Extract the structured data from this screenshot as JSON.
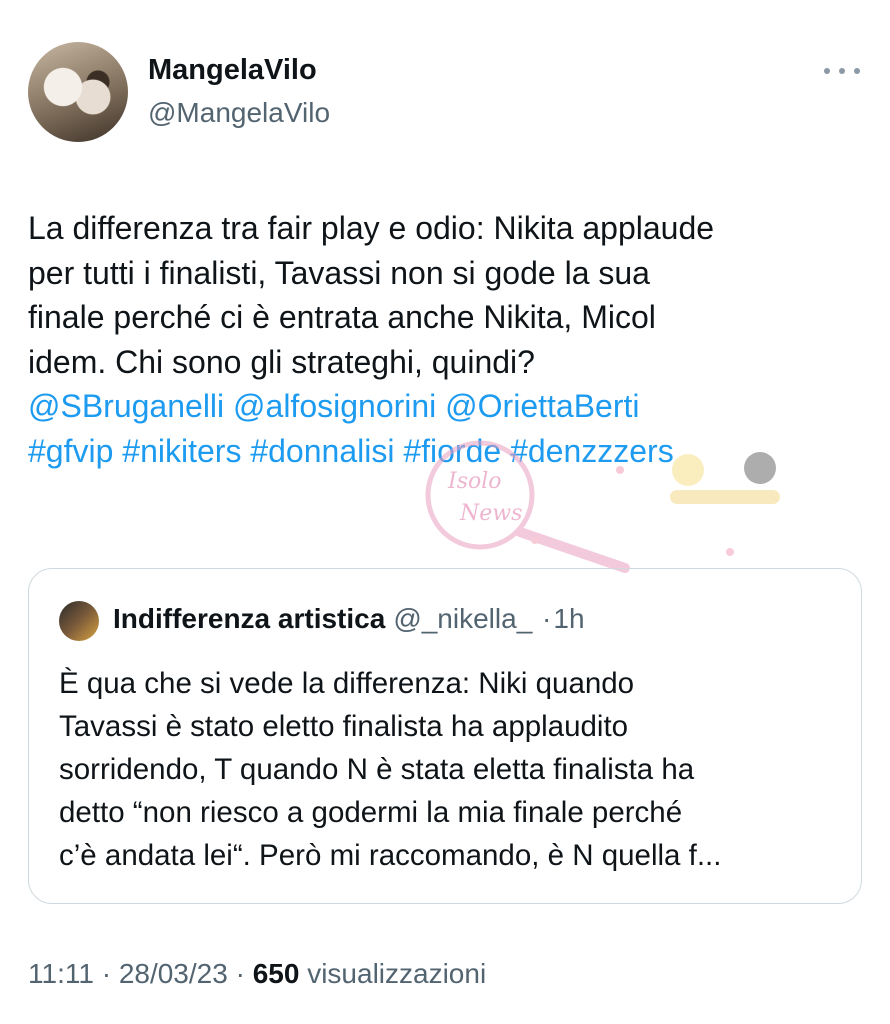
{
  "author": {
    "display_name": "MangelaVilo",
    "handle": "@MangelaVilo"
  },
  "tweet": {
    "lines": [
      "La differenza tra fair play e odio: Nikita applaude",
      "per tutti i finalisti, Tavassi non si gode la sua",
      "finale perché ci è entrata anche Nikita, Micol",
      "idem. Chi sono gli strateghi, quindi?"
    ],
    "mentions": [
      "@SBruganelli",
      "@alfosignorini",
      "@OriettaBerti"
    ],
    "hashtags": [
      "#gfvip",
      "#nikiters",
      "#donnalisi",
      "#fiorde",
      "#denzzzers"
    ]
  },
  "quote": {
    "display_name": "Indifferenza artistica",
    "handle": "@_nikella_",
    "separator": "·",
    "time": "1h",
    "lines": [
      "È qua che si vede la differenza: Niki quando",
      "Tavassi è stato eletto finalista ha applaudito",
      "sorridendo, T quando N è stata eletta finalista ha",
      "detto “non riesco a godermi la mia finale perché",
      "c’è andata lei“. Però mi raccomando, è N quella f..."
    ]
  },
  "meta": {
    "time": "11:11",
    "date": "28/03/23",
    "separator": "·",
    "views_count": "650",
    "views_label": "visualizzazioni"
  },
  "watermark": {
    "logo_text_1": "Isolo",
    "logo_text_2": "News"
  },
  "colors": {
    "link": "#1d9bf0",
    "secondary_text": "#536471",
    "primary_text": "#0f1419",
    "border": "#cfd9de"
  },
  "icons": {
    "more": "more-horizontal-icon"
  }
}
